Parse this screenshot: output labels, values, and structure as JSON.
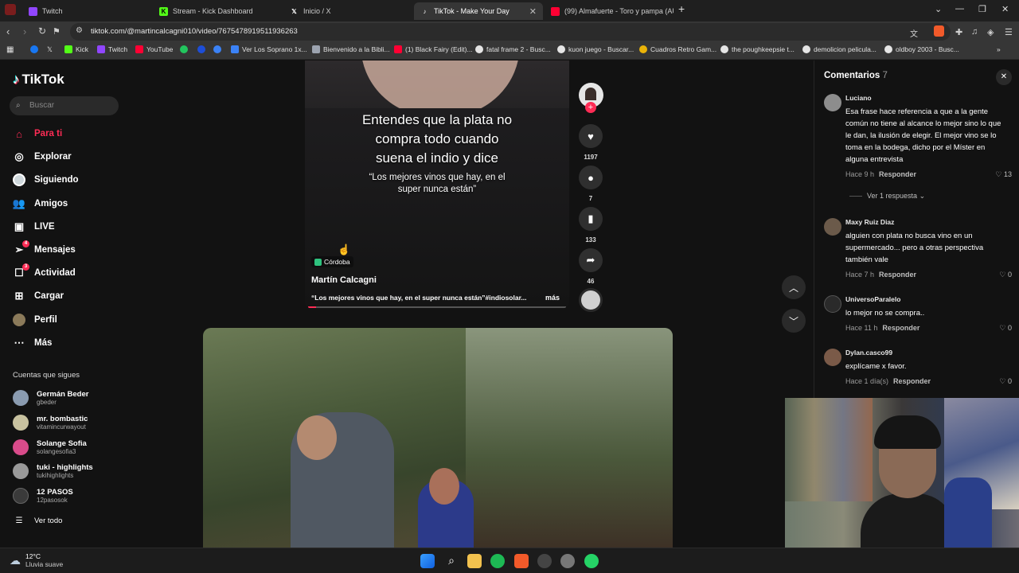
{
  "browser": {
    "tabs": [
      {
        "title": "Twitch",
        "icon": "twitch-icon",
        "color": "#9146ff"
      },
      {
        "title": "Stream - Kick Dashboard",
        "icon": "kick-icon",
        "color": "#53fc18"
      },
      {
        "title": "Inicio / X",
        "icon": "x-icon",
        "color": "#ffffff"
      },
      {
        "title": "TikTok - Make Your Day",
        "icon": "tiktok-icon",
        "color": "#ffffff"
      },
      {
        "title": "(99) Almafuerte - Toro y pampa (AUD",
        "icon": "youtube-icon",
        "color": "#ff0033"
      }
    ],
    "url": "tiktok.com/@martincalcagni010/video/7675478919511936263",
    "bookmarks": [
      {
        "label": "Kick",
        "color": "#53fc18"
      },
      {
        "label": "Twitch",
        "color": "#9146ff"
      },
      {
        "label": "YouTube",
        "color": "#ff0033"
      },
      {
        "label": "Ver Los Soprano 1x...",
        "color": "#3b82f6"
      },
      {
        "label": "Bienvenido a la Bibli...",
        "color": "#9ca3af"
      },
      {
        "label": "(1) Black Fairy (Edit)...",
        "color": "#ff0033"
      },
      {
        "label": "fatal frame 2 - Busc...",
        "color": "#e5e5e5"
      },
      {
        "label": "kuon juego - Buscar...",
        "color": "#e5e5e5"
      },
      {
        "label": "Cuadros Retro Gam...",
        "color": "#eab308"
      },
      {
        "label": "the poughkeepsie t...",
        "color": "#e5e5e5"
      },
      {
        "label": "demolicion pelicula...",
        "color": "#e5e5e5"
      },
      {
        "label": "oldboy 2003 - Busc...",
        "color": "#e5e5e5"
      }
    ]
  },
  "tiktok": {
    "logo": "TikTok",
    "search_placeholder": "Buscar",
    "nav": [
      {
        "label": "Para ti",
        "icon": "home-icon",
        "active": true
      },
      {
        "label": "Explorar",
        "icon": "compass-icon"
      },
      {
        "label": "Siguiendo",
        "icon": "following-icon"
      },
      {
        "label": "Amigos",
        "icon": "friends-icon"
      },
      {
        "label": "LIVE",
        "icon": "live-icon"
      },
      {
        "label": "Mensajes",
        "icon": "messages-icon",
        "badge": "4"
      },
      {
        "label": "Actividad",
        "icon": "activity-icon",
        "badge": "3"
      },
      {
        "label": "Cargar",
        "icon": "upload-icon"
      },
      {
        "label": "Perfil",
        "icon": "profile-icon"
      },
      {
        "label": "Más",
        "icon": "more-icon"
      }
    ],
    "following_title": "Cuentas que sigues",
    "following": [
      {
        "name": "Germán Beder",
        "user": "gbeder",
        "color": "#8a9bb0"
      },
      {
        "name": "mr. bombastic",
        "user": "vitamincurwayout",
        "color": "#c8c2a0"
      },
      {
        "name": "Solange Sofia",
        "user": "solangesofia3",
        "color": "#d94b8a"
      },
      {
        "name": "tuki - highlights",
        "user": "tukihighlights",
        "color": "#9a9a9a"
      },
      {
        "name": "12 PASOS",
        "user": "12pasosok",
        "color": "#3a3a3a"
      }
    ],
    "see_all": "Ver todo"
  },
  "video": {
    "caption_main": "Entendes que la plata no compra todo cuando suena el indio y dice",
    "caption_quote": "“Los mejores vinos que hay, en el super nunca están”",
    "location": "Córdoba",
    "author": "Martín Calcagni",
    "description": "“Los mejores vinos que hay, en el super nunca están”#indiosolar...",
    "more": "más",
    "likes": "1197",
    "comments": "7",
    "saves": "133",
    "shares": "46"
  },
  "comments_panel": {
    "title": "Comentarios",
    "count": "7",
    "items": [
      {
        "user": "Luciano",
        "text": "Esa frase hace referencia a que a la gente común no tiene al alcance lo mejor sino lo que le dan, la ilusión de elegir. El mejor vino se lo toma en la bodega, dicho por el Míster en alguna entrevista",
        "time": "Hace 9 h",
        "reply": "Responder",
        "likes": "13",
        "color": "#8d8d8d"
      },
      {
        "user": "Maxy Ruiz Diaz",
        "text": "alguien con plata no busca vino en un supermercado... pero a otras perspectiva también vale",
        "time": "Hace 7 h",
        "reply": "Responder",
        "likes": "0",
        "color": "#6b5a4a"
      },
      {
        "user": "UniversoParalelo",
        "text": "lo mejor no se compra..",
        "time": "Hace 11 h",
        "reply": "Responder",
        "likes": "0",
        "color": "#2a2a2a"
      },
      {
        "user": "Dylan.casco99",
        "text": "explícame x favor.",
        "time": "Hace 1 día(s)",
        "reply": "Responder",
        "likes": "0",
        "color": "#7a5a48"
      }
    ],
    "view_replies": "Ver 1 respuesta"
  },
  "taskbar": {
    "temp": "12°C",
    "weather": "Lluvia suave"
  }
}
